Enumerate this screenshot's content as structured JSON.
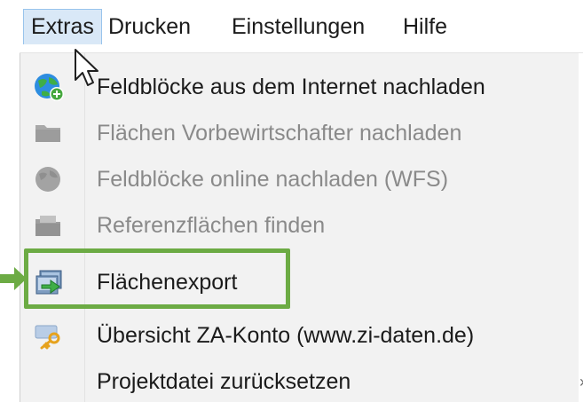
{
  "menubar": {
    "items": [
      {
        "label": "Extras",
        "active": true
      },
      {
        "label": "Drucken"
      },
      {
        "label": "Einstellungen"
      },
      {
        "label": "Hilfe"
      }
    ]
  },
  "dropdown": {
    "items": [
      {
        "label": "Feldblöcke aus dem Internet nachladen",
        "icon": "globe-download-icon",
        "enabled": true
      },
      {
        "label": "Flächen Vorbewirtschafter nachladen",
        "icon": "folder-icon",
        "enabled": false
      },
      {
        "label": "Feldblöcke online nachladen (WFS)",
        "icon": "globe-icon",
        "enabled": false
      },
      {
        "label": "Referenzflächen finden",
        "icon": "search-folder-icon",
        "enabled": false
      },
      {
        "label": "Flächenexport",
        "icon": "export-arrow-icon",
        "enabled": true
      },
      {
        "label": "Übersicht ZA-Konto (www.zi-daten.de)",
        "icon": "key-icon",
        "enabled": true
      },
      {
        "label": "Projektdatei zurücksetzen",
        "icon": "",
        "enabled": true
      }
    ]
  },
  "colors": {
    "highlight": "#6cab44",
    "active_menu_bg": "#d9e8f7",
    "disabled_text": "#8a8a8a"
  }
}
